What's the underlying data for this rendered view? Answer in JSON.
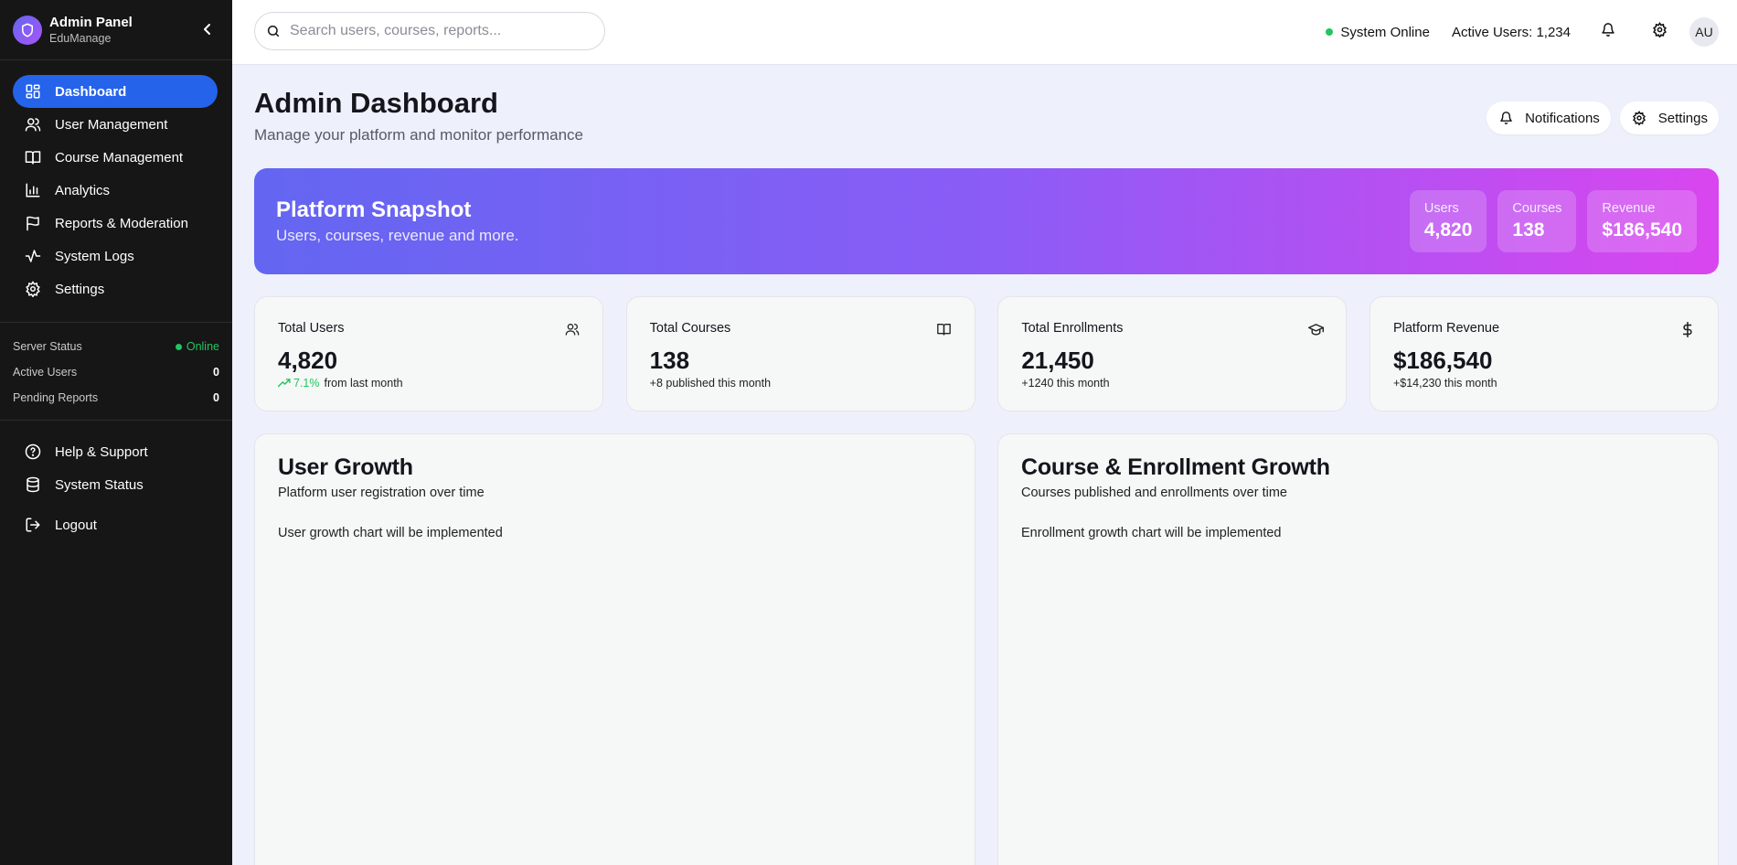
{
  "brand": {
    "title": "Admin Panel",
    "subtitle": "EduManage"
  },
  "sidebar": {
    "items": [
      {
        "label": "Dashboard",
        "icon": "dashboard-icon",
        "active": true
      },
      {
        "label": "User Management",
        "icon": "users-icon"
      },
      {
        "label": "Course Management",
        "icon": "book-icon"
      },
      {
        "label": "Analytics",
        "icon": "bar-chart-icon"
      },
      {
        "label": "Reports & Moderation",
        "icon": "flag-icon"
      },
      {
        "label": "System Logs",
        "icon": "activity-icon"
      },
      {
        "label": "Settings",
        "icon": "gear-icon"
      }
    ],
    "status": {
      "server_label": "Server Status",
      "server_value": "Online",
      "active_label": "Active Users",
      "active_value": "0",
      "pending_label": "Pending Reports",
      "pending_value": "0"
    },
    "bottom": [
      {
        "label": "Help & Support",
        "icon": "help-icon"
      },
      {
        "label": "System Status",
        "icon": "database-icon"
      }
    ],
    "logout": "Logout"
  },
  "topbar": {
    "search_placeholder": "Search users, courses, reports...",
    "system_status": "System Online",
    "active_users": "Active Users: 1,234",
    "avatar": "AU"
  },
  "header": {
    "title": "Admin Dashboard",
    "subtitle": "Manage your platform and monitor performance",
    "notifications": "Notifications",
    "settings": "Settings"
  },
  "snapshot": {
    "title": "Platform Snapshot",
    "subtitle": "Users, courses, revenue and more.",
    "stats": [
      {
        "label": "Users",
        "value": "4,820"
      },
      {
        "label": "Courses",
        "value": "138"
      },
      {
        "label": "Revenue",
        "value": "$186,540"
      }
    ]
  },
  "stats": [
    {
      "label": "Total Users",
      "value": "4,820",
      "trend": "7.1%",
      "sub": "from last month",
      "icon": "users-icon"
    },
    {
      "label": "Total Courses",
      "value": "138",
      "sub": "+8 published this month",
      "icon": "book-open-icon"
    },
    {
      "label": "Total Enrollments",
      "value": "21,450",
      "sub": "+1240 this month",
      "icon": "graduation-cap-icon"
    },
    {
      "label": "Platform Revenue",
      "value": "$186,540",
      "sub": "+$14,230 this month",
      "icon": "dollar-icon"
    }
  ],
  "panels": [
    {
      "title": "User Growth",
      "subtitle": "Platform user registration over time",
      "note": "User growth chart will be implemented"
    },
    {
      "title": "Course & Enrollment Growth",
      "subtitle": "Courses published and enrollments over time",
      "note": "Enrollment growth chart will be implemented"
    }
  ],
  "colors": {
    "sidebar_bg": "#161616",
    "accent": "#2563eb",
    "online": "#22c55e",
    "gradient_start": "#6366f1",
    "gradient_end": "#d946ef"
  }
}
